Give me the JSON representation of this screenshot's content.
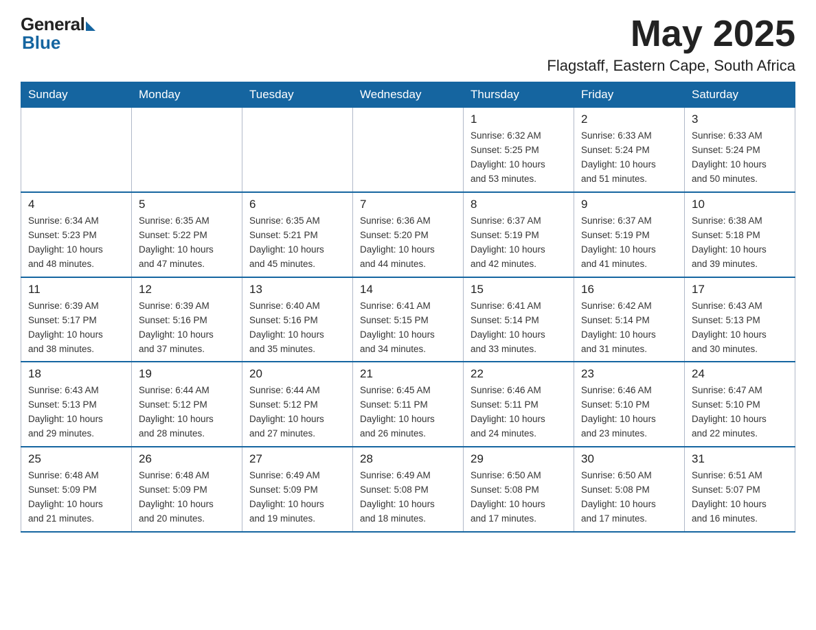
{
  "header": {
    "logo_general": "General",
    "logo_blue": "Blue",
    "month_title": "May 2025",
    "location": "Flagstaff, Eastern Cape, South Africa"
  },
  "days_of_week": [
    "Sunday",
    "Monday",
    "Tuesday",
    "Wednesday",
    "Thursday",
    "Friday",
    "Saturday"
  ],
  "weeks": [
    [
      {
        "day": "",
        "info": ""
      },
      {
        "day": "",
        "info": ""
      },
      {
        "day": "",
        "info": ""
      },
      {
        "day": "",
        "info": ""
      },
      {
        "day": "1",
        "info": "Sunrise: 6:32 AM\nSunset: 5:25 PM\nDaylight: 10 hours\nand 53 minutes."
      },
      {
        "day": "2",
        "info": "Sunrise: 6:33 AM\nSunset: 5:24 PM\nDaylight: 10 hours\nand 51 minutes."
      },
      {
        "day": "3",
        "info": "Sunrise: 6:33 AM\nSunset: 5:24 PM\nDaylight: 10 hours\nand 50 minutes."
      }
    ],
    [
      {
        "day": "4",
        "info": "Sunrise: 6:34 AM\nSunset: 5:23 PM\nDaylight: 10 hours\nand 48 minutes."
      },
      {
        "day": "5",
        "info": "Sunrise: 6:35 AM\nSunset: 5:22 PM\nDaylight: 10 hours\nand 47 minutes."
      },
      {
        "day": "6",
        "info": "Sunrise: 6:35 AM\nSunset: 5:21 PM\nDaylight: 10 hours\nand 45 minutes."
      },
      {
        "day": "7",
        "info": "Sunrise: 6:36 AM\nSunset: 5:20 PM\nDaylight: 10 hours\nand 44 minutes."
      },
      {
        "day": "8",
        "info": "Sunrise: 6:37 AM\nSunset: 5:19 PM\nDaylight: 10 hours\nand 42 minutes."
      },
      {
        "day": "9",
        "info": "Sunrise: 6:37 AM\nSunset: 5:19 PM\nDaylight: 10 hours\nand 41 minutes."
      },
      {
        "day": "10",
        "info": "Sunrise: 6:38 AM\nSunset: 5:18 PM\nDaylight: 10 hours\nand 39 minutes."
      }
    ],
    [
      {
        "day": "11",
        "info": "Sunrise: 6:39 AM\nSunset: 5:17 PM\nDaylight: 10 hours\nand 38 minutes."
      },
      {
        "day": "12",
        "info": "Sunrise: 6:39 AM\nSunset: 5:16 PM\nDaylight: 10 hours\nand 37 minutes."
      },
      {
        "day": "13",
        "info": "Sunrise: 6:40 AM\nSunset: 5:16 PM\nDaylight: 10 hours\nand 35 minutes."
      },
      {
        "day": "14",
        "info": "Sunrise: 6:41 AM\nSunset: 5:15 PM\nDaylight: 10 hours\nand 34 minutes."
      },
      {
        "day": "15",
        "info": "Sunrise: 6:41 AM\nSunset: 5:14 PM\nDaylight: 10 hours\nand 33 minutes."
      },
      {
        "day": "16",
        "info": "Sunrise: 6:42 AM\nSunset: 5:14 PM\nDaylight: 10 hours\nand 31 minutes."
      },
      {
        "day": "17",
        "info": "Sunrise: 6:43 AM\nSunset: 5:13 PM\nDaylight: 10 hours\nand 30 minutes."
      }
    ],
    [
      {
        "day": "18",
        "info": "Sunrise: 6:43 AM\nSunset: 5:13 PM\nDaylight: 10 hours\nand 29 minutes."
      },
      {
        "day": "19",
        "info": "Sunrise: 6:44 AM\nSunset: 5:12 PM\nDaylight: 10 hours\nand 28 minutes."
      },
      {
        "day": "20",
        "info": "Sunrise: 6:44 AM\nSunset: 5:12 PM\nDaylight: 10 hours\nand 27 minutes."
      },
      {
        "day": "21",
        "info": "Sunrise: 6:45 AM\nSunset: 5:11 PM\nDaylight: 10 hours\nand 26 minutes."
      },
      {
        "day": "22",
        "info": "Sunrise: 6:46 AM\nSunset: 5:11 PM\nDaylight: 10 hours\nand 24 minutes."
      },
      {
        "day": "23",
        "info": "Sunrise: 6:46 AM\nSunset: 5:10 PM\nDaylight: 10 hours\nand 23 minutes."
      },
      {
        "day": "24",
        "info": "Sunrise: 6:47 AM\nSunset: 5:10 PM\nDaylight: 10 hours\nand 22 minutes."
      }
    ],
    [
      {
        "day": "25",
        "info": "Sunrise: 6:48 AM\nSunset: 5:09 PM\nDaylight: 10 hours\nand 21 minutes."
      },
      {
        "day": "26",
        "info": "Sunrise: 6:48 AM\nSunset: 5:09 PM\nDaylight: 10 hours\nand 20 minutes."
      },
      {
        "day": "27",
        "info": "Sunrise: 6:49 AM\nSunset: 5:09 PM\nDaylight: 10 hours\nand 19 minutes."
      },
      {
        "day": "28",
        "info": "Sunrise: 6:49 AM\nSunset: 5:08 PM\nDaylight: 10 hours\nand 18 minutes."
      },
      {
        "day": "29",
        "info": "Sunrise: 6:50 AM\nSunset: 5:08 PM\nDaylight: 10 hours\nand 17 minutes."
      },
      {
        "day": "30",
        "info": "Sunrise: 6:50 AM\nSunset: 5:08 PM\nDaylight: 10 hours\nand 17 minutes."
      },
      {
        "day": "31",
        "info": "Sunrise: 6:51 AM\nSunset: 5:07 PM\nDaylight: 10 hours\nand 16 minutes."
      }
    ]
  ]
}
